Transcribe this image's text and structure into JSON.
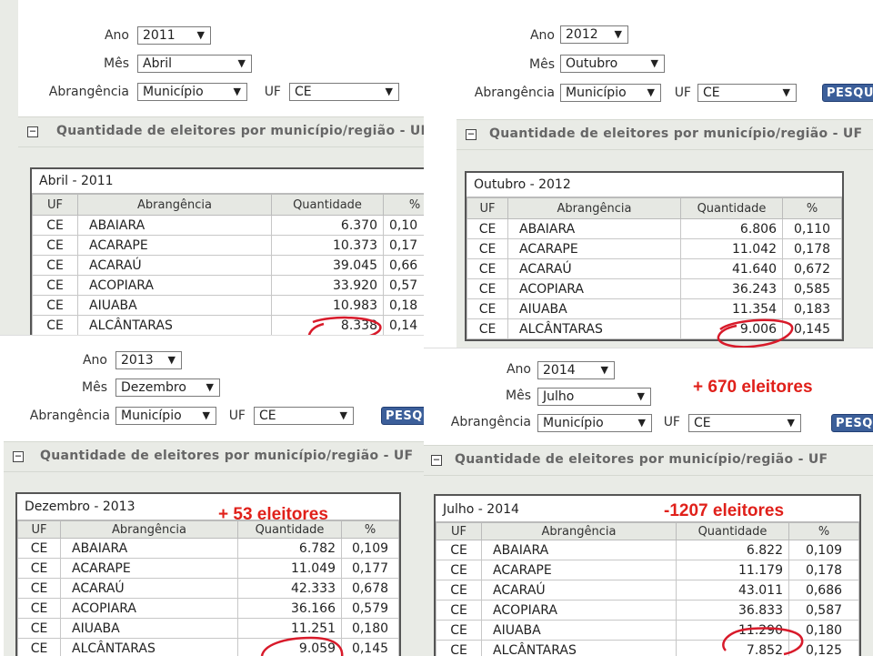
{
  "labels": {
    "ano": "Ano",
    "mes": "Mês",
    "abrangencia": "Abrangência",
    "uf": "UF",
    "button": "PESQUISAR"
  },
  "panels": [
    {
      "ano": "2011",
      "mes": "Abril",
      "abrangencia": "Município",
      "uf": "CE",
      "section_title": "Quantidade de eleitores por município/região - UF",
      "caption": "Abril - 2011",
      "headers": [
        "UF",
        "Abrangência",
        "Quantidade",
        "%"
      ],
      "rows": [
        [
          "CE",
          "ABAIARA",
          "6.370",
          "0,10"
        ],
        [
          "CE",
          "ACARAPE",
          "10.373",
          "0,17"
        ],
        [
          "CE",
          "ACARAÚ",
          "39.045",
          "0,66"
        ],
        [
          "CE",
          "ACOPIARA",
          "33.920",
          "0,57"
        ],
        [
          "CE",
          "AIUABA",
          "10.983",
          "0,18"
        ],
        [
          "CE",
          "ALCÂNTARAS",
          "8.338",
          "0,14"
        ]
      ]
    },
    {
      "ano": "2012",
      "mes": "Outubro",
      "abrangencia": "Município",
      "uf": "CE",
      "section_title": "Quantidade de eleitores por município/região - UF",
      "caption": "Outubro - 2012",
      "headers": [
        "UF",
        "Abrangência",
        "Quantidade",
        "%"
      ],
      "rows": [
        [
          "CE",
          "ABAIARA",
          "6.806",
          "0,110"
        ],
        [
          "CE",
          "ACARAPE",
          "11.042",
          "0,178"
        ],
        [
          "CE",
          "ACARAÚ",
          "41.640",
          "0,672"
        ],
        [
          "CE",
          "ACOPIARA",
          "36.243",
          "0,585"
        ],
        [
          "CE",
          "AIUABA",
          "11.354",
          "0,183"
        ],
        [
          "CE",
          "ALCÂNTARAS",
          "9.006",
          "0,145"
        ]
      ]
    },
    {
      "ano": "2013",
      "mes": "Dezembro",
      "abrangencia": "Município",
      "uf": "CE",
      "section_title": "Quantidade de eleitores por município/região - UF",
      "caption": "Dezembro - 2013",
      "headers": [
        "UF",
        "Abrangência",
        "Quantidade",
        "%"
      ],
      "rows": [
        [
          "CE",
          "ABAIARA",
          "6.782",
          "0,109"
        ],
        [
          "CE",
          "ACARAPE",
          "11.049",
          "0,177"
        ],
        [
          "CE",
          "ACARAÚ",
          "42.333",
          "0,678"
        ],
        [
          "CE",
          "ACOPIARA",
          "36.166",
          "0,579"
        ],
        [
          "CE",
          "AIUABA",
          "11.251",
          "0,180"
        ],
        [
          "CE",
          "ALCÂNTARAS",
          "9.059",
          "0,145"
        ]
      ]
    },
    {
      "ano": "2014",
      "mes": "Julho",
      "abrangencia": "Município",
      "uf": "CE",
      "section_title": "Quantidade de eleitores por município/região - UF",
      "caption": "Julho - 2014",
      "headers": [
        "UF",
        "Abrangência",
        "Quantidade",
        "%"
      ],
      "rows": [
        [
          "CE",
          "ABAIARA",
          "6.822",
          "0,109"
        ],
        [
          "CE",
          "ACARAPE",
          "11.179",
          "0,178"
        ],
        [
          "CE",
          "ACARAÚ",
          "43.011",
          "0,686"
        ],
        [
          "CE",
          "ACOPIARA",
          "36.833",
          "0,587"
        ],
        [
          "CE",
          "AIUABA",
          "11.290",
          "0,180"
        ],
        [
          "CE",
          "ALCÂNTARAS",
          "7.852",
          "0,125"
        ]
      ]
    }
  ],
  "annotations": {
    "note_2012": "+ 670 eleitores",
    "note_2013": "+ 53  eleitores",
    "note_2014": "-1207  eleitores",
    "color": "#e0201a"
  }
}
